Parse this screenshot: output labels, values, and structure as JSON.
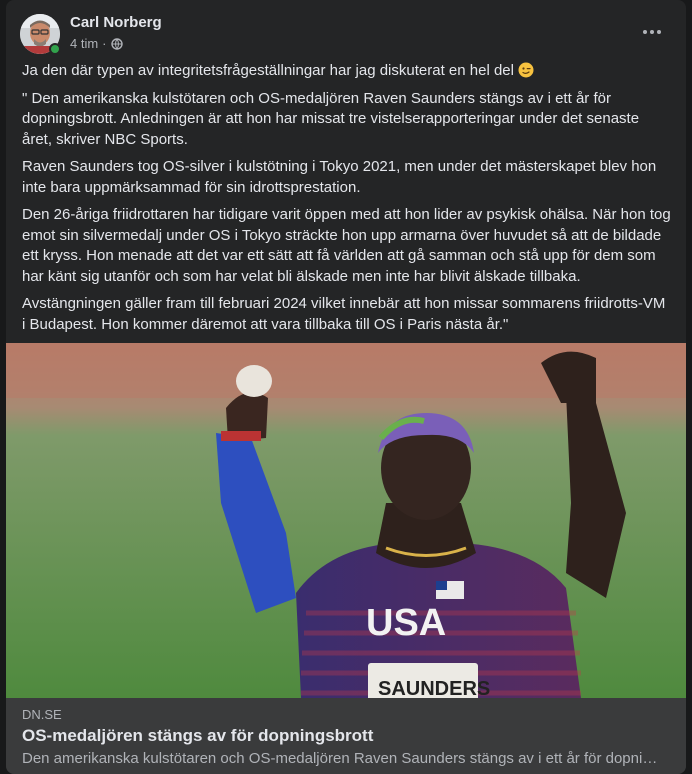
{
  "post": {
    "author": "Carl Norberg",
    "time": "4 tim",
    "separator": "·",
    "paragraphs": [
      "Ja den där typen av integritetsfrågeställningar har jag diskuterat en hel del",
      "\" Den amerikanska kulstötaren och OS-medaljören Raven Saunders stängs av i ett år för dopningsbrott. Anledningen är att hon har missat tre vistelserapporteringar under det senaste året, skriver NBC Sports.",
      "Raven Saunders tog OS-silver i kulstötning i Tokyo 2021, men under det mästerskapet blev hon inte bara uppmärksammad för sin idrottsprestation.",
      "Den 26-åriga friidrottaren har tidigare varit öppen med att hon lider av psykisk ohälsa. När hon tog emot sin silvermedalj under OS i Tokyo sträckte hon upp armarna över huvudet så att de bildade ett kryss. Hon menade att det var ett sätt att få världen att gå samman och stå upp för dem som har känt sig utanför och som har velat bli älskade men inte har blivit älskade tillbaka.",
      "Avstängningen gäller fram till februari 2024 vilket innebär att hon missar sommarens friidrotts-VM i Budapest. Hon kommer däremot att vara tillbaka till OS i Paris nästa år.\""
    ],
    "emoji": "winking-face",
    "audience_icon": "globe-icon",
    "more_icon": "more-options-icon"
  },
  "photo": {
    "jersey_text": "USA",
    "bib_text": "SAUNDERS"
  },
  "link": {
    "domain": "DN.SE",
    "title": "OS-medaljören stängs av för dopningsbrott",
    "description": "Den amerikanska kulstötaren och OS-medaljören Raven Saunders stängs av i ett år för dopni…"
  },
  "colors": {
    "card_bg": "#242526",
    "page_bg": "#18191a",
    "text_primary": "#e4e6eb",
    "text_secondary": "#b0b3b8",
    "link_bg": "#3a3b3c",
    "online": "#31a24c"
  }
}
